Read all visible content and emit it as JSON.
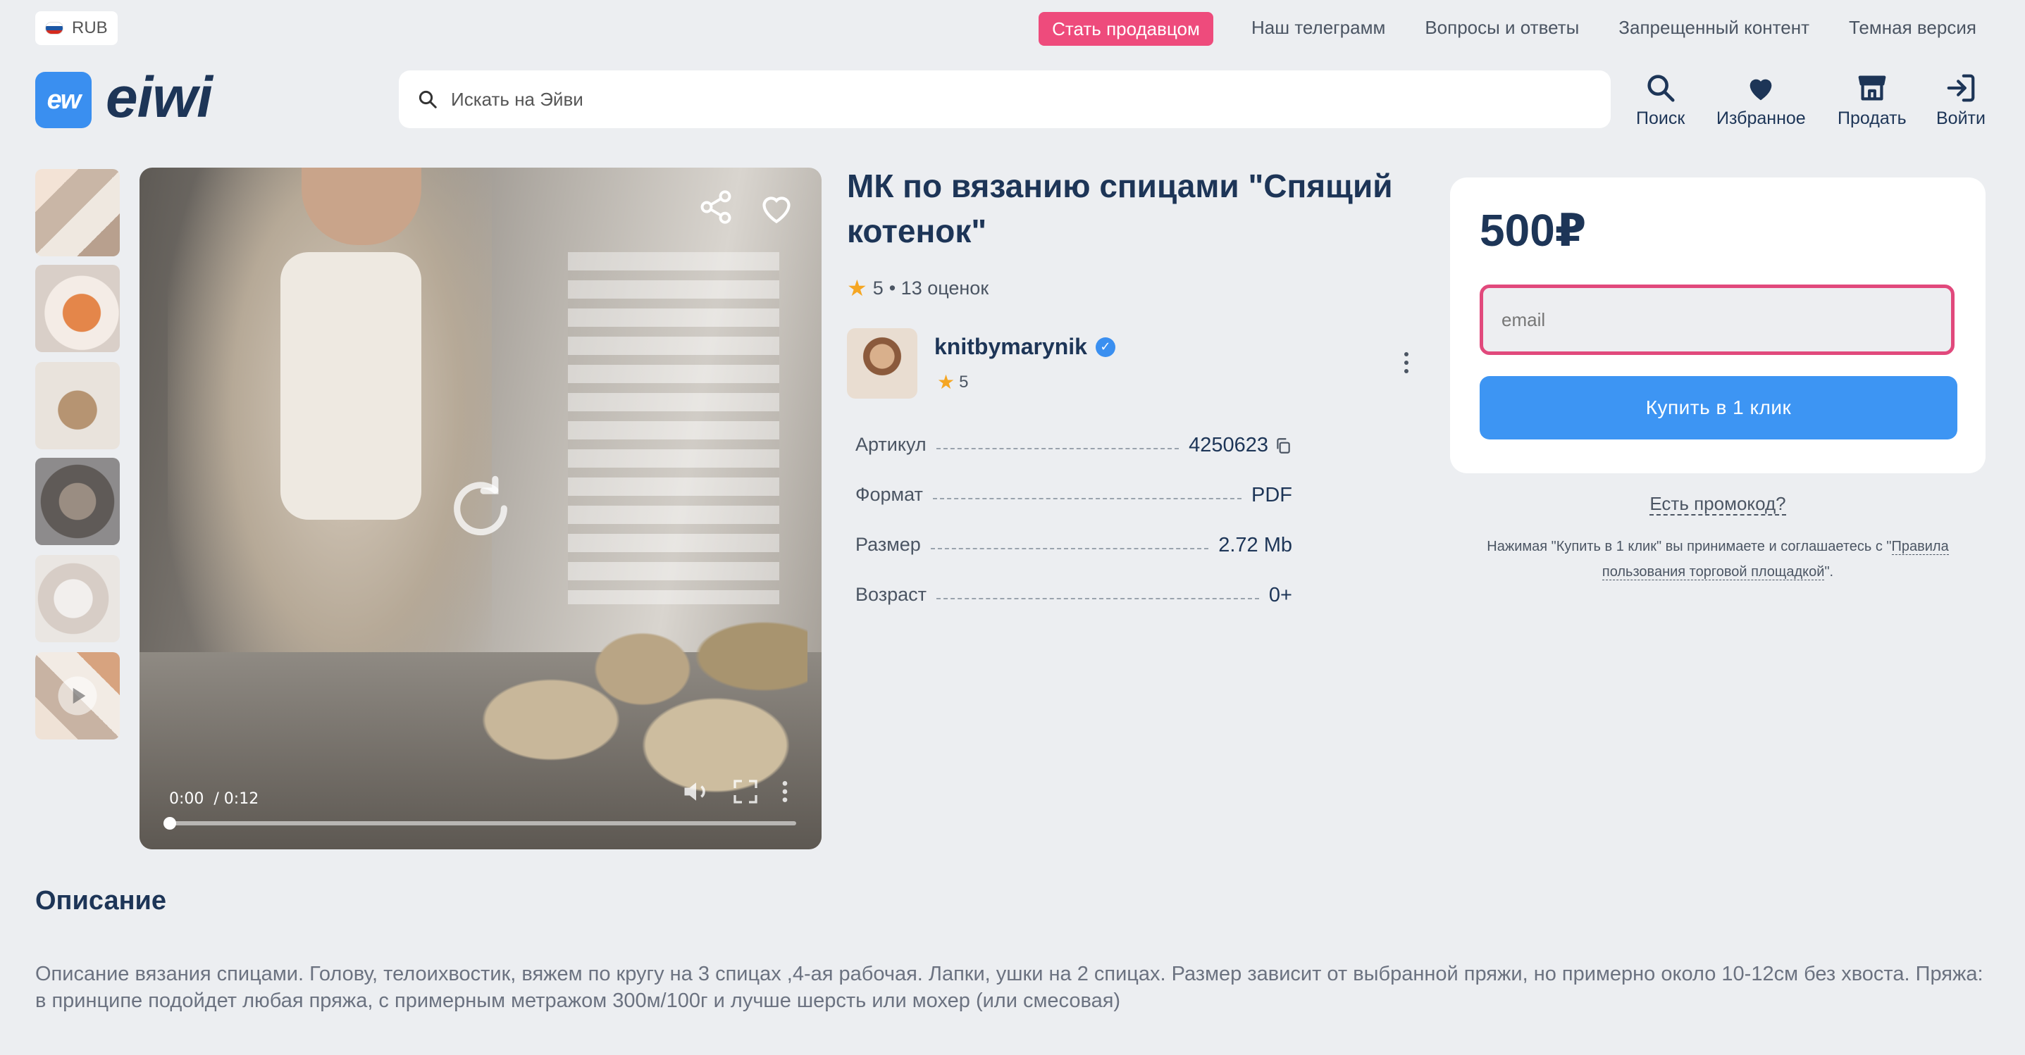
{
  "topbar": {
    "currency": "RUB",
    "seller_cta": "Стать продавцом",
    "links": [
      "Наш телеграмм",
      "Вопросы и ответы",
      "Запрещенный контент",
      "Темная версия"
    ]
  },
  "header": {
    "logo_badge": "ew",
    "logo_text": "eiwi",
    "search_placeholder": "Искать на Эйви",
    "nav": [
      {
        "label": "Поиск",
        "icon": "search-icon"
      },
      {
        "label": "Избранное",
        "icon": "heart-icon"
      },
      {
        "label": "Продать",
        "icon": "store-icon"
      },
      {
        "label": "Войти",
        "icon": "login-icon"
      }
    ]
  },
  "player": {
    "current_time": "0:00",
    "duration": "/ 0:12",
    "progress": 0
  },
  "product": {
    "title": "МК по вязанию спицами \"Спящий котенок\"",
    "rating": "5",
    "rating_count": "• 13 оценок",
    "seller": {
      "name": "knitbymarynik",
      "rating": "5"
    },
    "specs": [
      {
        "key": "Артикул",
        "value": "4250623"
      },
      {
        "key": "Формат",
        "value": "PDF"
      },
      {
        "key": "Размер",
        "value": "2.72 Mb"
      },
      {
        "key": "Возраст",
        "value": "0+"
      }
    ]
  },
  "purchase": {
    "price": "500₽",
    "email_placeholder": "email",
    "buy_button": "Купить в 1 клик",
    "promo": "Есть промокод?",
    "terms_prefix": "Нажимая \"Купить в 1 клик\" вы принимаете и соглашаетесь с \"",
    "terms_link": "Правила пользования торговой площадкой",
    "terms_suffix": "\"."
  },
  "description": {
    "heading": "Описание",
    "text": "Описание вязания спицами. Голову, телоихвостик, вяжем по кругу на 3 спицах ,4-ая рабочая. Лапки, ушки на 2 спицах. Размер зависит от выбранной пряжи, но примерно около 10-12см без хвоста. Пряжа: в принципе подойдет любая пряжа, с примерным метражом 300м/100г и лучше шерсть или мохер (или смесовая)"
  },
  "colors": {
    "accent_pink": "#ee4b7c",
    "accent_blue": "#3d95f3",
    "navy": "#1d3557",
    "star": "#f5a623"
  }
}
